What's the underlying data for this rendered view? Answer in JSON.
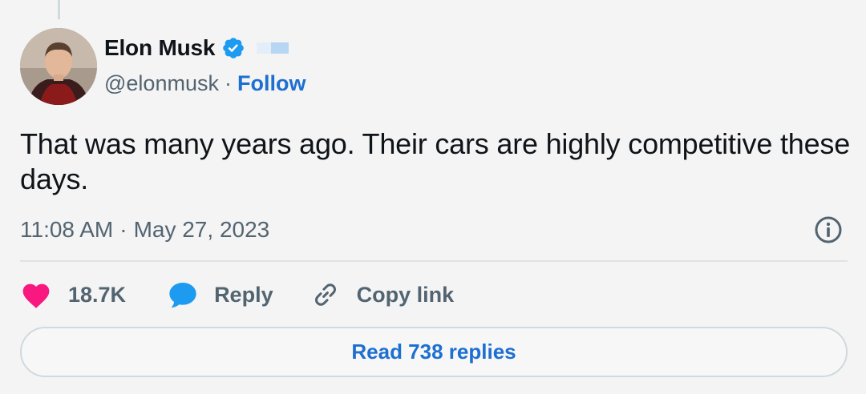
{
  "author": {
    "display_name": "Elon Musk",
    "handle": "@elonmusk",
    "verified": true
  },
  "follow_label": "Follow",
  "separator": "·",
  "tweet": {
    "text": "That was many years ago. Their cars are highly competitive these days.",
    "time": "11:08 AM",
    "date": "May 27, 2023"
  },
  "actions": {
    "likes": "18.7K",
    "reply_label": "Reply",
    "copy_link_label": "Copy link"
  },
  "read_replies_label": "Read 738 replies",
  "colors": {
    "link": "#1d6fd1",
    "verified": "#1d9bf0",
    "like": "#f91880",
    "muted": "#536471",
    "background": "#f4f4f4"
  }
}
